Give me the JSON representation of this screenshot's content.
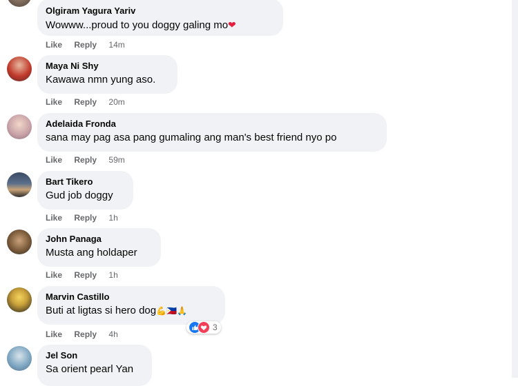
{
  "comments": [
    {
      "name": "Olgiram Yagura Yariv",
      "text": "Wowww...proud to you doggy galing mo",
      "time": "14m",
      "avatar": "avatar"
    },
    {
      "name": "Maya Ni Shy",
      "text": "Kawawa nmn yung aso.",
      "time": "20m",
      "avatar": "avatar"
    },
    {
      "name": "Adelaida Fronda",
      "text": "sana may pag asa pang gumaling ang man's best friend nyo po",
      "time": "59m",
      "avatar": "avatar"
    },
    {
      "name": "Bart Tikero",
      "text": "Gud job doggy",
      "time": "1h",
      "avatar": "avatar"
    },
    {
      "name": "John Panaga",
      "text": "Musta ang holdaper",
      "time": "1h",
      "avatar": "avatar"
    },
    {
      "name": "Marvin Castillo",
      "text": "Buti at ligtas si hero dog",
      "time": "4h",
      "reaction_count": "3",
      "avatar": "avatar"
    },
    {
      "name": "Jel Son",
      "text": "Sa orient pearl Yan",
      "avatar": "avatar"
    }
  ],
  "actions": {
    "like": "Like",
    "reply": "Reply"
  },
  "colors": {
    "bubble": "#f0f2f5",
    "meta": "#65676b",
    "like": "#1877f2",
    "love": "#f33e58"
  }
}
